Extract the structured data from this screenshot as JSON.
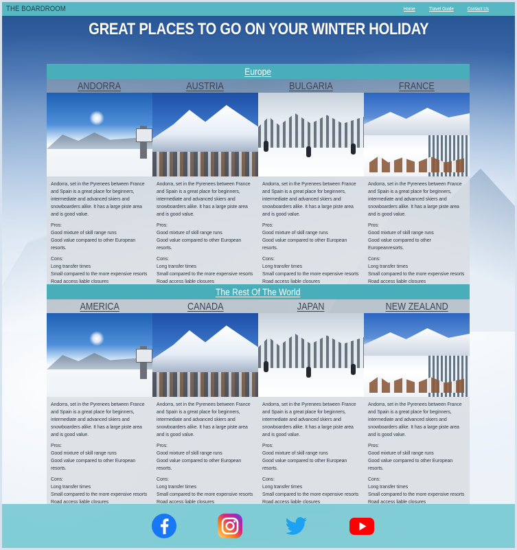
{
  "nav": {
    "brand": "THE BOARDROOM",
    "links": [
      "Home",
      "Travel Guide",
      "Contact Us"
    ]
  },
  "hero": {
    "title": "GREAT PLACES TO GO ON YOUR WINTER HOLIDAY"
  },
  "sections": [
    {
      "title": "Europe",
      "resorts": [
        {
          "name": "ANDORRA",
          "description": "Andorra, set in the Pyrenees between France and Spain is a great place for beginners, intermediate and advanced skiers and snowboarders alike. It has a large piste area and is good value.",
          "pros_label": "Pros:",
          "pros": [
            "Good mixture of skill range runs",
            "Good value compared to other European resorts."
          ],
          "cons_label": "Cons:",
          "cons": [
            "Long transfer times",
            "Small compared to the more expensive resorts",
            "Road access liable closures"
          ]
        },
        {
          "name": "AUSTRIA",
          "description": "Andorra, set in the Pyrenees between France and Spain is a great place for beginners, intermediate and advanced skiers and snowboarders alike. It has a large piste area and is good value.",
          "pros_label": "Pros:",
          "pros": [
            "Good mixture of skill range runs",
            "Good value compared to other European resorts."
          ],
          "cons_label": "Cons:",
          "cons": [
            "Long transfer times",
            "Small compared to the more expensive resorts",
            "Road access liable closures"
          ]
        },
        {
          "name": "BULGARIA",
          "description": "Andorra, set in the Pyrenees between France and Spain is a great place for beginners, intermediate and advanced skiers and snowboarders alike. It has a large piste area and is good value.",
          "pros_label": "Pros:",
          "pros": [
            "Good mixture of skill range runs",
            "Good value compared to other European resorts."
          ],
          "cons_label": "Cons:",
          "cons": [
            "Long transfer times",
            "Small compared to the more expensive resorts",
            "Road access liable closures"
          ]
        },
        {
          "name": "FRANCE",
          "description": "Andorra, set in the Pyrenees between France and Spain is a great place for beginners, intermediate and advanced skiers and snowboarders alike. It has a large piste area and is good value.",
          "pros_label": "Pros:",
          "pros": [
            "Good mixture of skill range runs",
            "Good value compared to other Europeanresorts."
          ],
          "cons_label": "Cons:",
          "cons": [
            "Long transfer times",
            "Small compared to the more expensive resorts",
            "Road access liable closures"
          ]
        }
      ]
    },
    {
      "title": "The Rest Of The World",
      "resorts": [
        {
          "name": "AMERICA",
          "description": "Andorra, set in the Pyrenees between France and Spain is a great place for beginners, intermediate and advanced skiers and snowboarders alike. It has a large piste area and is good value.",
          "pros_label": "Pros:",
          "pros": [
            "Good mixture of skill range runs",
            "Good value compared to other European resorts."
          ],
          "cons_label": "Cons:",
          "cons": [
            "Long transfer times",
            "Small compared to the more expensive resorts",
            "Road access liable closures"
          ]
        },
        {
          "name": "CANADA",
          "description": "Andorra, set in the Pyrenees between France and Spain is a great place for beginners, intermediate and advanced skiers and snowboarders alike. It has a large piste area and is good value.",
          "pros_label": "Pros:",
          "pros": [
            "Good mixture of skill range runs",
            "Good value compared to other European resorts."
          ],
          "cons_label": "Cons:",
          "cons": [
            "Long transfer times",
            "Small compared to the more expensive resorts",
            "Road access liable closures"
          ]
        },
        {
          "name": "JAPAN",
          "description": "Andorra, set in the Pyrenees between France and Spain is a great place for beginners, intermediate and advanced skiers and snowboarders alike. It has a large piste area and is good value.",
          "pros_label": "Pros:",
          "pros": [
            "Good mixture of skill range runs",
            "Good value compared to other European resorts."
          ],
          "cons_label": "Cons:",
          "cons": [
            "Long transfer times",
            "Small compared to the more expensive resorts",
            "Road access liable closures"
          ]
        },
        {
          "name": "NEW ZEALAND",
          "description": "Andorra, set in the Pyrenees between France and Spain is a great place for beginners, intermediate and advanced skiers and snowboarders alike. It has a large piste area and is good value.",
          "pros_label": "Pros:",
          "pros": [
            "Good mixture of skill range runs",
            "Good value compared to other European resorts."
          ],
          "cons_label": "Cons:",
          "cons": [
            "Long transfer times",
            "Small compared to the more expensive resorts",
            "Road access liable closures"
          ]
        }
      ]
    }
  ],
  "footer": {
    "icons": [
      "facebook-icon",
      "instagram-icon",
      "twitter-icon",
      "youtube-icon"
    ]
  },
  "colors": {
    "accent": "#57b7c2",
    "section_bar": "#49aeb9",
    "facebook": "#1877f2",
    "twitter": "#1da1f2",
    "youtube": "#ff0000"
  }
}
